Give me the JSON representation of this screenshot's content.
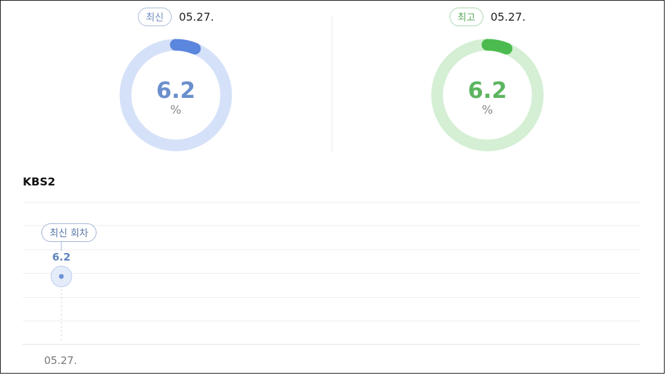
{
  "summary": {
    "recent": {
      "badge": "최신",
      "date": "05.27.",
      "value": "6.2",
      "unit": "%",
      "fraction": 0.062,
      "color": "#5b86de",
      "track_color": "#d5e1f8"
    },
    "best": {
      "badge": "최고",
      "date": "05.27.",
      "value": "6.2",
      "unit": "%",
      "fraction": 0.062,
      "color": "#4cbb4f",
      "track_color": "#d4efd4"
    }
  },
  "channel": "KBS2",
  "chart_data": {
    "type": "line",
    "x": [
      "05.27."
    ],
    "series": [
      {
        "values": [
          6.2
        ]
      }
    ],
    "point_labels": [
      "6.2"
    ],
    "annotation": "최신 회차",
    "grid": true
  }
}
